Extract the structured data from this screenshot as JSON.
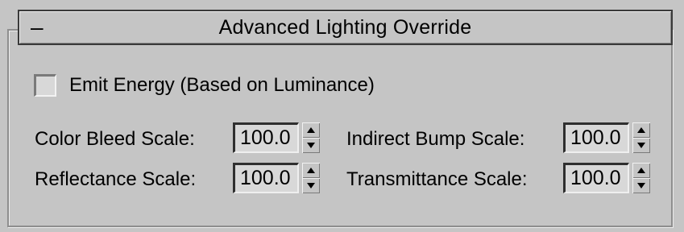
{
  "rollout": {
    "collapse_glyph": "–",
    "title": "Advanced Lighting Override"
  },
  "emit_energy": {
    "label": "Emit Energy (Based on Luminance)",
    "checked": false
  },
  "params": {
    "color_bleed": {
      "label": "Color Bleed Scale:",
      "value": "100.0"
    },
    "indirect_bump": {
      "label": "Indirect Bump Scale:",
      "value": "100.0"
    },
    "reflectance": {
      "label": "Reflectance Scale:",
      "value": "100.0"
    },
    "transmittance": {
      "label": "Transmittance Scale:",
      "value": "100.0"
    }
  },
  "icons": {
    "spin_up": "triangle-up-icon",
    "spin_down": "triangle-down-icon"
  }
}
